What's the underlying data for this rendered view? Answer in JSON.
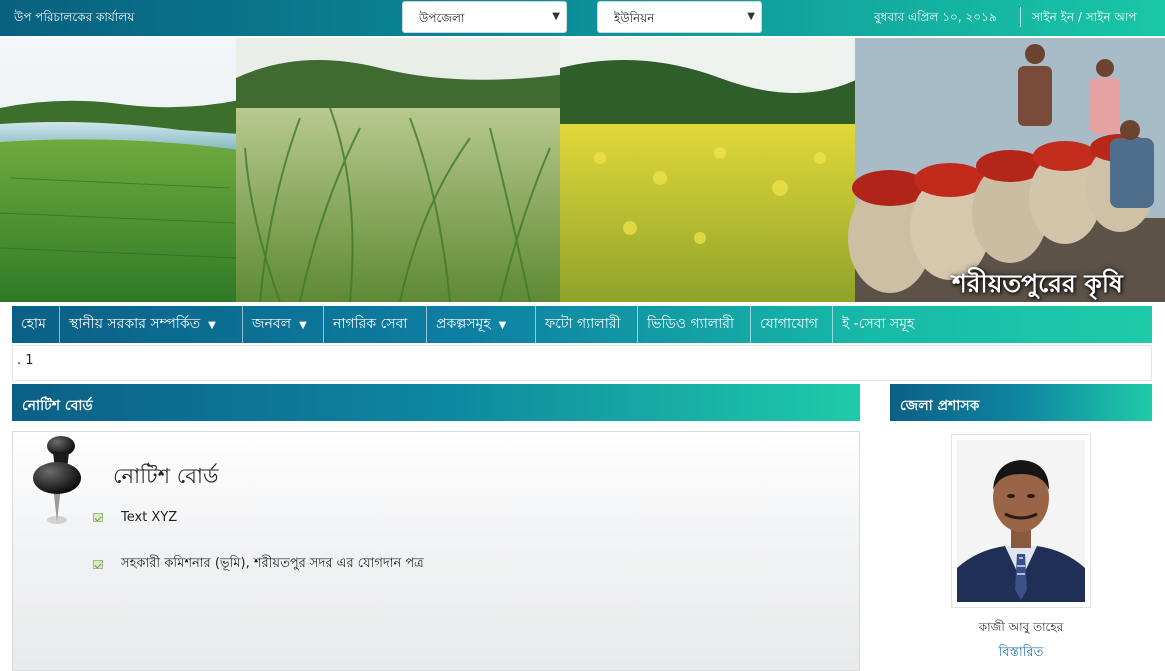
{
  "topbar": {
    "office": "উপ পরিচালকের কার্যালয়",
    "upazila_select": "উপজেলা",
    "union_select": "ইউনিয়ন",
    "date": "বুধবার এপ্রিল ১০, ২০১৯",
    "sign_links": "সাইন ইন / সাইন আপ"
  },
  "banner": {
    "title": "শরীয়তপুরের কৃষি"
  },
  "nav": {
    "items": [
      {
        "label": "হোম",
        "dropdown": false
      },
      {
        "label": "স্থানীয় সরকার সম্পর্কিত",
        "dropdown": true
      },
      {
        "label": "জনবল",
        "dropdown": true
      },
      {
        "label": "নাগরিক সেবা",
        "dropdown": false
      },
      {
        "label": "প্রকল্পসমূহ",
        "dropdown": true
      },
      {
        "label": "ফটো গ্যালারী",
        "dropdown": false
      },
      {
        "label": "ভিডিও গ্যালারী",
        "dropdown": false
      },
      {
        "label": "যোগাযোগ",
        "dropdown": false
      },
      {
        "label": "ই -সেবা সমূহ",
        "dropdown": false
      }
    ]
  },
  "ticker": {
    "text": ". 1"
  },
  "notice": {
    "bar_title": "নোটিশ বোর্ড",
    "heading": "নোটিশ বোর্ড",
    "items": [
      "Text XYZ",
      "সহকারী কমিশনার (ভূমি), শরীয়তপুর সদর এর যোগদান পত্র"
    ]
  },
  "sidebar": {
    "bar_title": "জেলা প্রশাসক",
    "name": "কাজী আবু তাহের",
    "details_link": "বিস্তারিত"
  },
  "colors": {
    "accent_dark": "#0b5f86",
    "accent_light": "#1fcba9",
    "link": "#1a73a8"
  }
}
